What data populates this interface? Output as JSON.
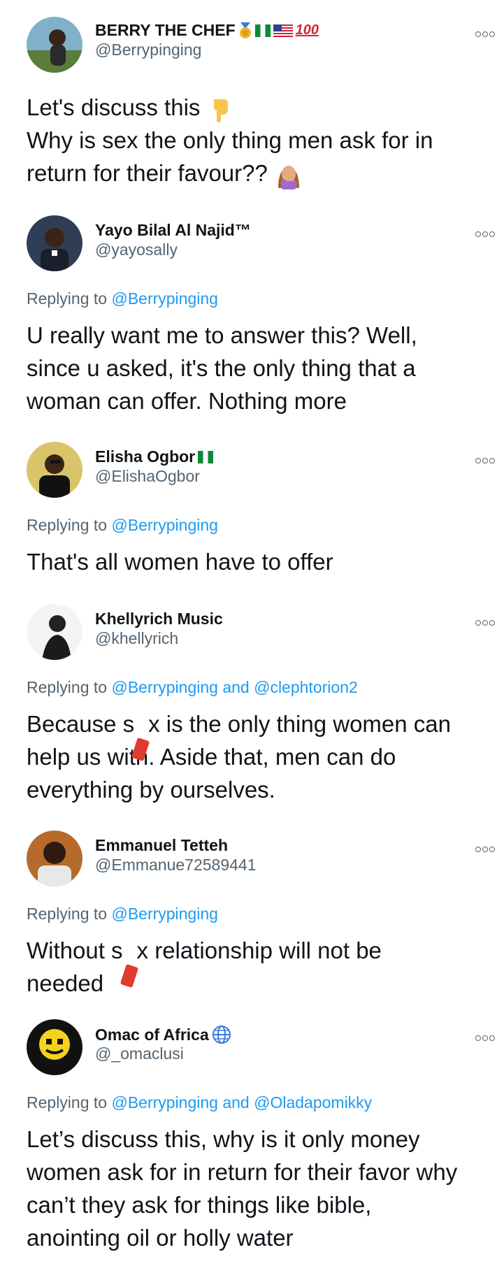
{
  "tweets": [
    {
      "name": "BERRY THE CHEF",
      "handle": "@Berrypinging",
      "hundred_text": "100",
      "body_lines": [
        "Let's discuss this",
        "Why is sex the only thing men ask for in",
        "return for their favour??"
      ]
    },
    {
      "name": "Yayo Bilal Al Najid™",
      "handle": "@yayosally",
      "replying_prefix": "Replying to",
      "mentions": "@Berrypinging",
      "body_lines": [
        "U really want me to answer this? Well,",
        "since u asked, it's the only thing that a",
        "woman can offer. Nothing more"
      ]
    },
    {
      "name": "Elisha Ogbor",
      "handle": "@ElishaOgbor",
      "replying_prefix": "Replying to",
      "mentions": "@Berrypinging",
      "body_lines": [
        "That's all women have to offer"
      ]
    },
    {
      "name": "Khellyrich Music",
      "handle": "@khellyrich",
      "replying_prefix": "Replying to",
      "mentions": "@Berrypinging and @clephtorion2",
      "body_l1_pre": "Because s",
      "body_l1_post": "x is the only thing women can",
      "body_lines": [
        "help us with. Aside that, men can do",
        "everything by ourselves."
      ]
    },
    {
      "name": "Emmanuel Tetteh",
      "handle": "@Emmanue72589441",
      "replying_prefix": "Replying to",
      "mentions": "@Berrypinging",
      "body_l1_pre": "Without s",
      "body_l1_post": "x relationship will not be",
      "body_lines": [
        "needed"
      ]
    },
    {
      "name": "Omac of Africa",
      "handle": "@_omaclusi",
      "replying_prefix": "Replying to",
      "mentions": "@Berrypinging and @Oladapomikky",
      "body_lines": [
        "Let’s discuss this, why is it only money",
        "women ask for in return for their favor why",
        "can’t they ask for things like bible,",
        "anointing oil or holly water"
      ]
    }
  ],
  "colors": {
    "text": "#0f1419",
    "secondary": "#536471",
    "mention": "#1d9bf0"
  },
  "icons": [
    "more-options-icon",
    "medal-icon",
    "nigeria-flag-icon",
    "us-flag-icon",
    "hundred-points-icon",
    "pointing-down-icon",
    "facepalm-icon",
    "globe-icon"
  ]
}
